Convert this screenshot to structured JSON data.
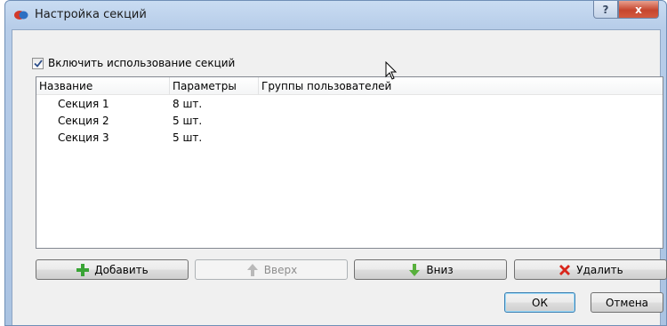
{
  "window": {
    "title": "Настройка секций",
    "help_label": "?",
    "close_label": "x"
  },
  "settings": {
    "enable_label": "Включить использование секций",
    "enable_checked": true
  },
  "table": {
    "columns": [
      "Название",
      "Параметры",
      "Группы пользователей"
    ],
    "rows": [
      {
        "name": "Секция 1",
        "params": "8 шт.",
        "groups": ""
      },
      {
        "name": "Секция 2",
        "params": "5 шт.",
        "groups": ""
      },
      {
        "name": "Секция 3",
        "params": "5 шт.",
        "groups": ""
      }
    ]
  },
  "buttons": {
    "add": "Добавить",
    "up": "Вверх",
    "down": "Вниз",
    "delete": "Удалить",
    "ok": "ОК",
    "cancel": "Отмена"
  },
  "icons": {
    "add": "plus-green-icon",
    "up": "arrow-up-icon",
    "down": "arrow-down-green-icon",
    "delete": "cross-red-icon"
  },
  "colors": {
    "add_icon": "#39a435",
    "delete_icon": "#d9261c",
    "up_icon_disabled": "#b9b9b9",
    "down_icon": "#58b03c"
  }
}
